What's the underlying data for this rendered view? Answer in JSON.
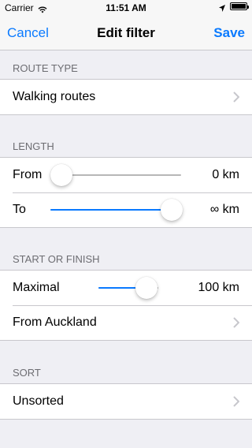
{
  "status_bar": {
    "carrier": "Carrier",
    "time": "11:51 AM",
    "icons": [
      "wifi-icon",
      "location-icon",
      "battery-icon"
    ]
  },
  "nav": {
    "cancel_label": "Cancel",
    "title": "Edit filter",
    "save_label": "Save"
  },
  "colors": {
    "accent": "#0a7aff",
    "background": "#efeff4",
    "section_header": "#6d6d72"
  },
  "sections": {
    "route_type": {
      "header": "ROUTE TYPE",
      "value": "Walking routes"
    },
    "length": {
      "header": "LENGTH",
      "from_label": "From",
      "from_value": "0 km",
      "from_level": 0,
      "to_label": "To",
      "to_value": "∞ km",
      "to_level": 1
    },
    "start_finish": {
      "header": "START OR FINISH",
      "maximal_label": "Maximal",
      "maximal_value": "100 km",
      "maximal_level": 0.8,
      "location": "From Auckland"
    },
    "sort": {
      "header": "SORT",
      "value": "Unsorted"
    }
  }
}
